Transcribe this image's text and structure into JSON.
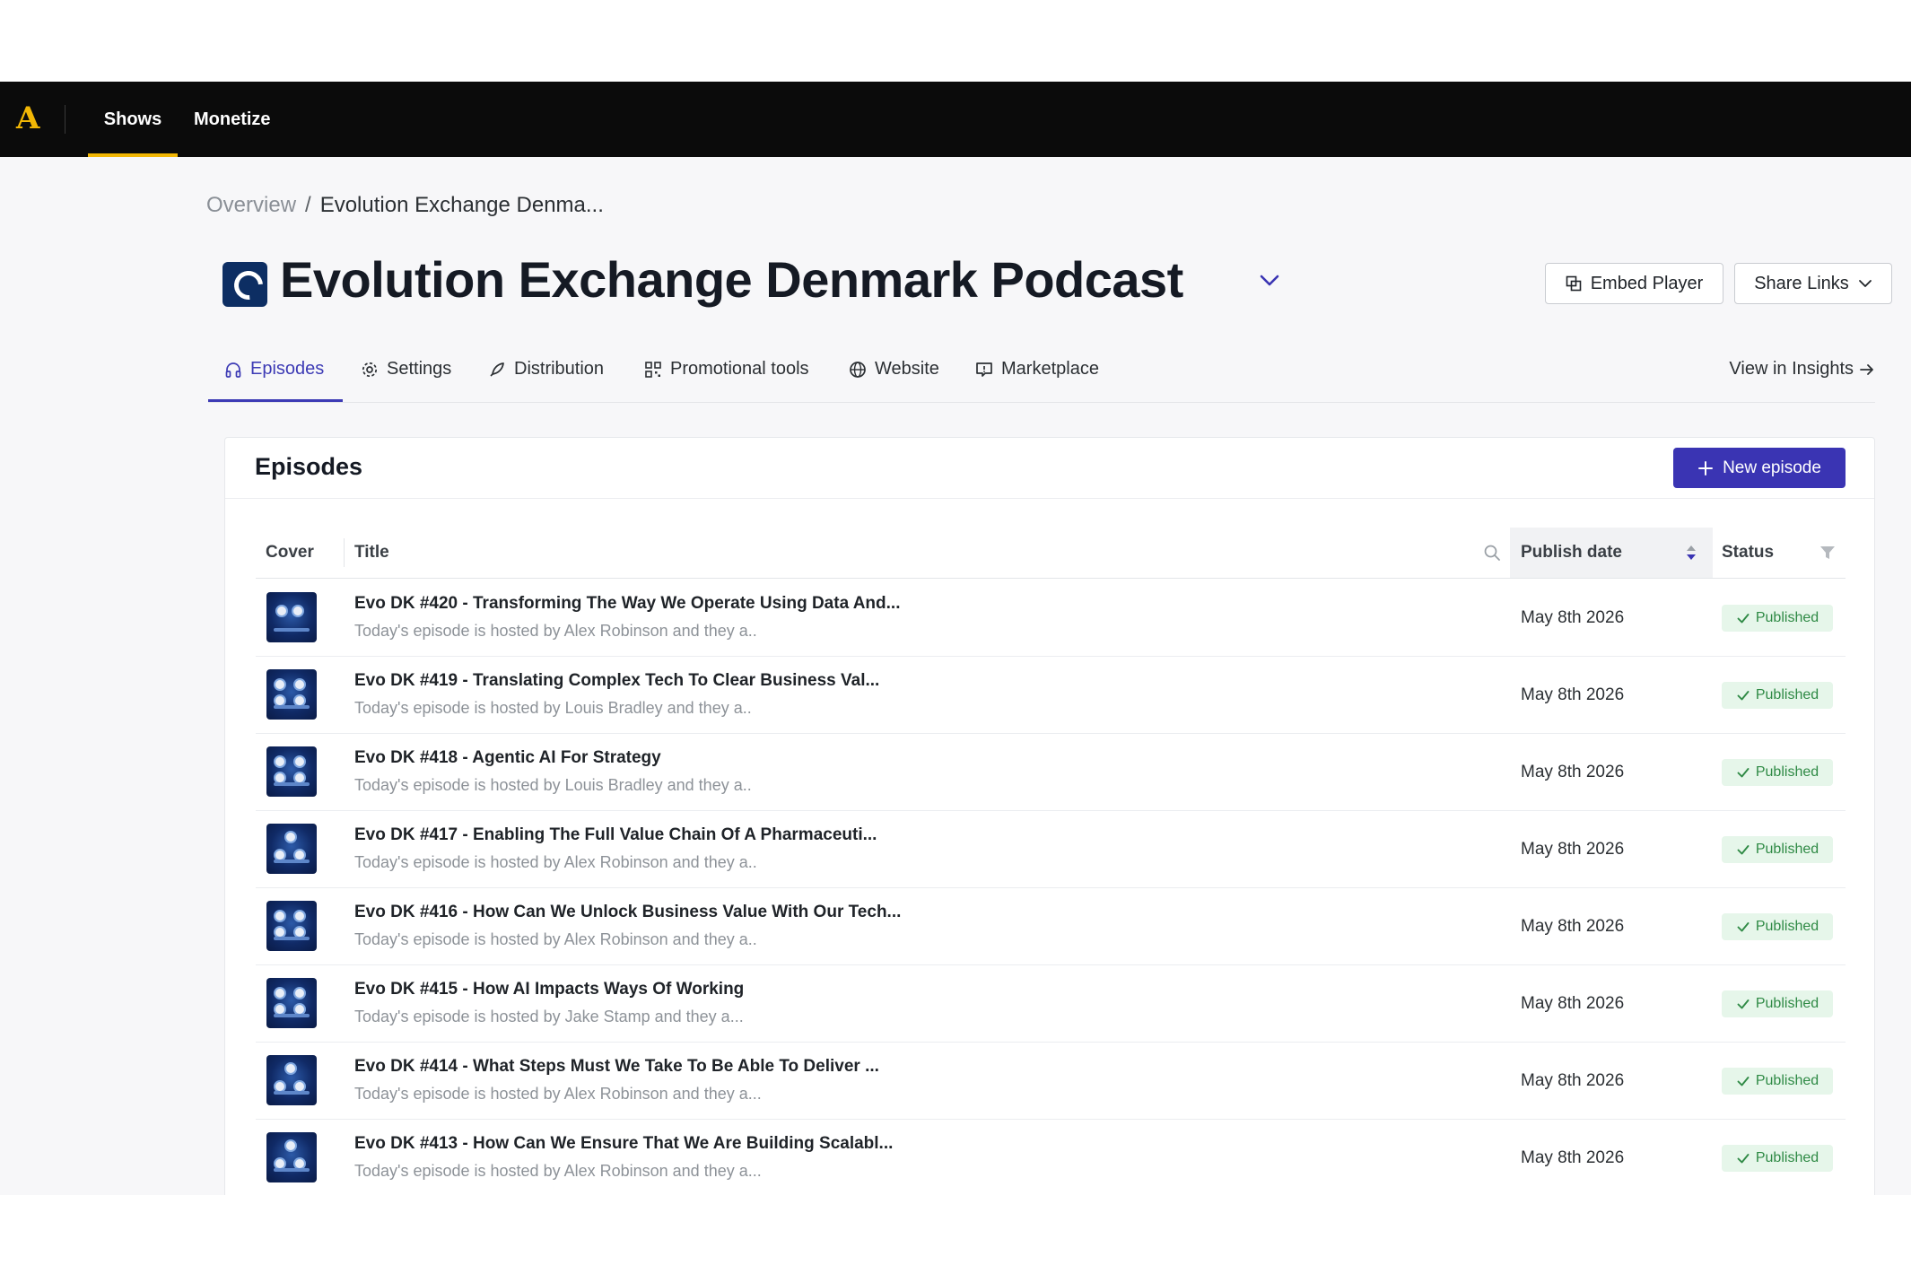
{
  "nav": {
    "logo": "A",
    "items": [
      {
        "label": "Shows"
      },
      {
        "label": "Monetize"
      }
    ]
  },
  "breadcrumb": {
    "parent": "Overview",
    "separator": "/",
    "current": "Evolution Exchange Denma..."
  },
  "show": {
    "title": "Evolution Exchange Denmark Podcast"
  },
  "header_buttons": {
    "embed": "Embed Player",
    "share": "Share Links"
  },
  "tabs": [
    {
      "label": "Episodes",
      "icon": "headphones-icon"
    },
    {
      "label": "Settings",
      "icon": "gear-icon"
    },
    {
      "label": "Distribution",
      "icon": "rocket-icon"
    },
    {
      "label": "Promotional tools",
      "icon": "qr-code-icon"
    },
    {
      "label": "Website",
      "icon": "globe-icon"
    },
    {
      "label": "Marketplace",
      "icon": "marketplace-icon"
    }
  ],
  "insights_link": "View in Insights",
  "episodes_card": {
    "title": "Episodes",
    "new_button": "New episode",
    "columns": {
      "cover": "Cover",
      "title": "Title",
      "publish_date": "Publish date",
      "status": "Status"
    },
    "rows": [
      {
        "title": "Evo DK #420 - Transforming The Way We Operate Using Data And...",
        "desc": "Today's episode is hosted by Alex Robinson and they a..",
        "date": "May 8th 2026",
        "status": "Published"
      },
      {
        "title": "Evo DK #419 - Translating Complex Tech To Clear Business Val...",
        "desc": "Today's episode is hosted by Louis Bradley and they a..",
        "date": "May 8th 2026",
        "status": "Published"
      },
      {
        "title": "Evo DK #418 - Agentic AI For Strategy",
        "desc": "Today's episode is hosted by Louis Bradley and they a..",
        "date": "May 8th 2026",
        "status": "Published"
      },
      {
        "title": "Evo DK #417 - Enabling The Full Value Chain Of A Pharmaceuti...",
        "desc": "Today's episode is hosted by Alex Robinson and they a..",
        "date": "May 8th 2026",
        "status": "Published"
      },
      {
        "title": "Evo DK #416 - How Can We Unlock Business Value With Our Tech...",
        "desc": "Today's episode is hosted by Alex Robinson and they a..",
        "date": "May 8th 2026",
        "status": "Published"
      },
      {
        "title": "Evo DK #415 - How AI Impacts Ways Of Working",
        "desc": "Today's episode is hosted by Jake Stamp and they a...",
        "date": "May 8th 2026",
        "status": "Published"
      },
      {
        "title": "Evo DK #414 - What Steps Must We Take To Be Able To Deliver ...",
        "desc": "Today's episode is hosted by Alex Robinson and they a...",
        "date": "May 8th 2026",
        "status": "Published"
      },
      {
        "title": "Evo DK #413 - How Can We Ensure That We Are Building Scalabl...",
        "desc": "Today's episode is hosted by Alex Robinson and they a...",
        "date": "May 8th 2026",
        "status": "Published"
      }
    ]
  },
  "colors": {
    "accent": "#3a34b3",
    "brand_gold": "#f2b705",
    "nav_bg": "#0b0b0b",
    "published_bg": "#e6f6ea",
    "published_text": "#2f8a45"
  }
}
